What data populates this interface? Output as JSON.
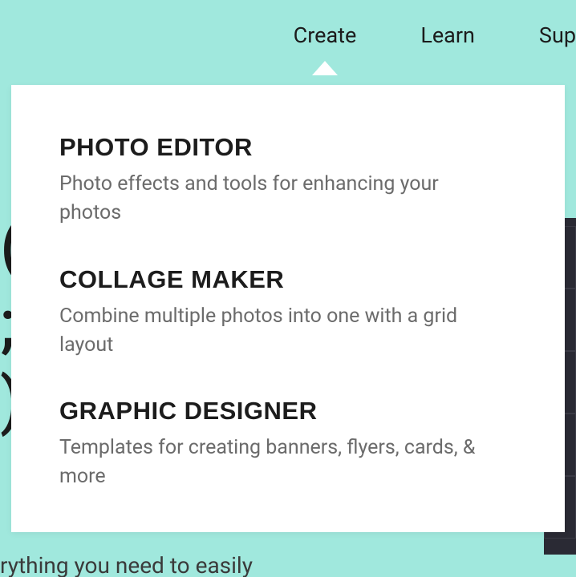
{
  "nav": {
    "items": [
      {
        "label": "Create",
        "active": true
      },
      {
        "label": "Learn",
        "active": false
      },
      {
        "label": "Sup",
        "active": false
      }
    ]
  },
  "dropdown": {
    "items": [
      {
        "title": "PHOTO EDITOR",
        "desc": "Photo effects and tools for enhancing your photos"
      },
      {
        "title": "COLLAGE MAKER",
        "desc": "Combine multiple photos into one with a grid layout"
      },
      {
        "title": "GRAPHIC DESIGNER",
        "desc": "Templates for creating banners, flyers, cards, & more"
      }
    ]
  },
  "background": {
    "hero_fragment": "(\n;\n)",
    "sub_fragment": "rything you need to easily"
  }
}
